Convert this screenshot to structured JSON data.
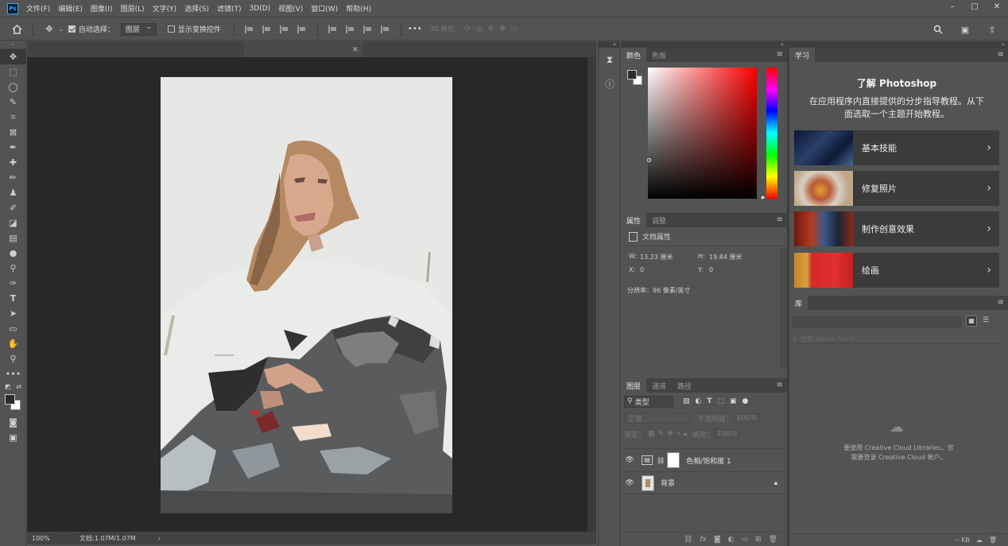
{
  "app": {
    "logo": "Ps"
  },
  "menu": [
    "文件(F)",
    "编辑(E)",
    "图像(I)",
    "图层(L)",
    "文字(Y)",
    "选择(S)",
    "滤镜(T)",
    "3D(D)",
    "视图(V)",
    "窗口(W)",
    "帮助(H)"
  ],
  "window_controls": {
    "minimize": "–",
    "maximize": "□",
    "close": "✕"
  },
  "options": {
    "auto_select_label": "自动选择：",
    "auto_select_value": "图层",
    "show_transform_label": "显示变换控件",
    "mode_3d_label": "3D 模式：",
    "more": "•••"
  },
  "document": {
    "tab_close": "×",
    "zoom": "100%",
    "doc_info": "文档:1.07M/1.07M",
    "status_arrow": "›"
  },
  "color_panel": {
    "tabs": [
      "颜色",
      "色板"
    ]
  },
  "properties_panel": {
    "tabs": [
      "属性",
      "调整"
    ],
    "doc_props_label": "文档属性",
    "w_label": "W:",
    "w_value": "13.23 厘米",
    "h_label": "H:",
    "h_value": "19.84 厘米",
    "x_label": "X:",
    "x_value": "0",
    "y_label": "Y:",
    "y_value": "0",
    "resolution": "分辨率：96 像素/英寸"
  },
  "layers_panel": {
    "tabs": [
      "图层",
      "通道",
      "路径"
    ],
    "kind_filter": "类型",
    "blend_mode": "正常",
    "opacity_label": "不透明度：",
    "opacity_value": "100%",
    "lock_label": "锁定：",
    "fill_label": "填充：",
    "fill_value": "100%",
    "layers": [
      {
        "name": "色相/饱和度 1",
        "type": "adjustment"
      },
      {
        "name": "背景",
        "type": "background",
        "locked": true
      }
    ]
  },
  "learn_panel": {
    "tab": "学习",
    "title": "了解 Photoshop",
    "subtitle_line1": "在应用程序内直接提供的分步指导教程。从下",
    "subtitle_line2": "面选取一个主题开始教程。",
    "items": [
      {
        "label": "基本技能"
      },
      {
        "label": "修复照片"
      },
      {
        "label": "制作创意效果"
      },
      {
        "label": "绘画"
      }
    ]
  },
  "library_panel": {
    "tab": "库",
    "search_placeholder": "搜索 Adobe Stock",
    "msg_line1": "要使用 Creative Cloud Libraries，您",
    "msg_line2": "需要登录 Creative Cloud 帐户。",
    "size": "-- KB"
  }
}
